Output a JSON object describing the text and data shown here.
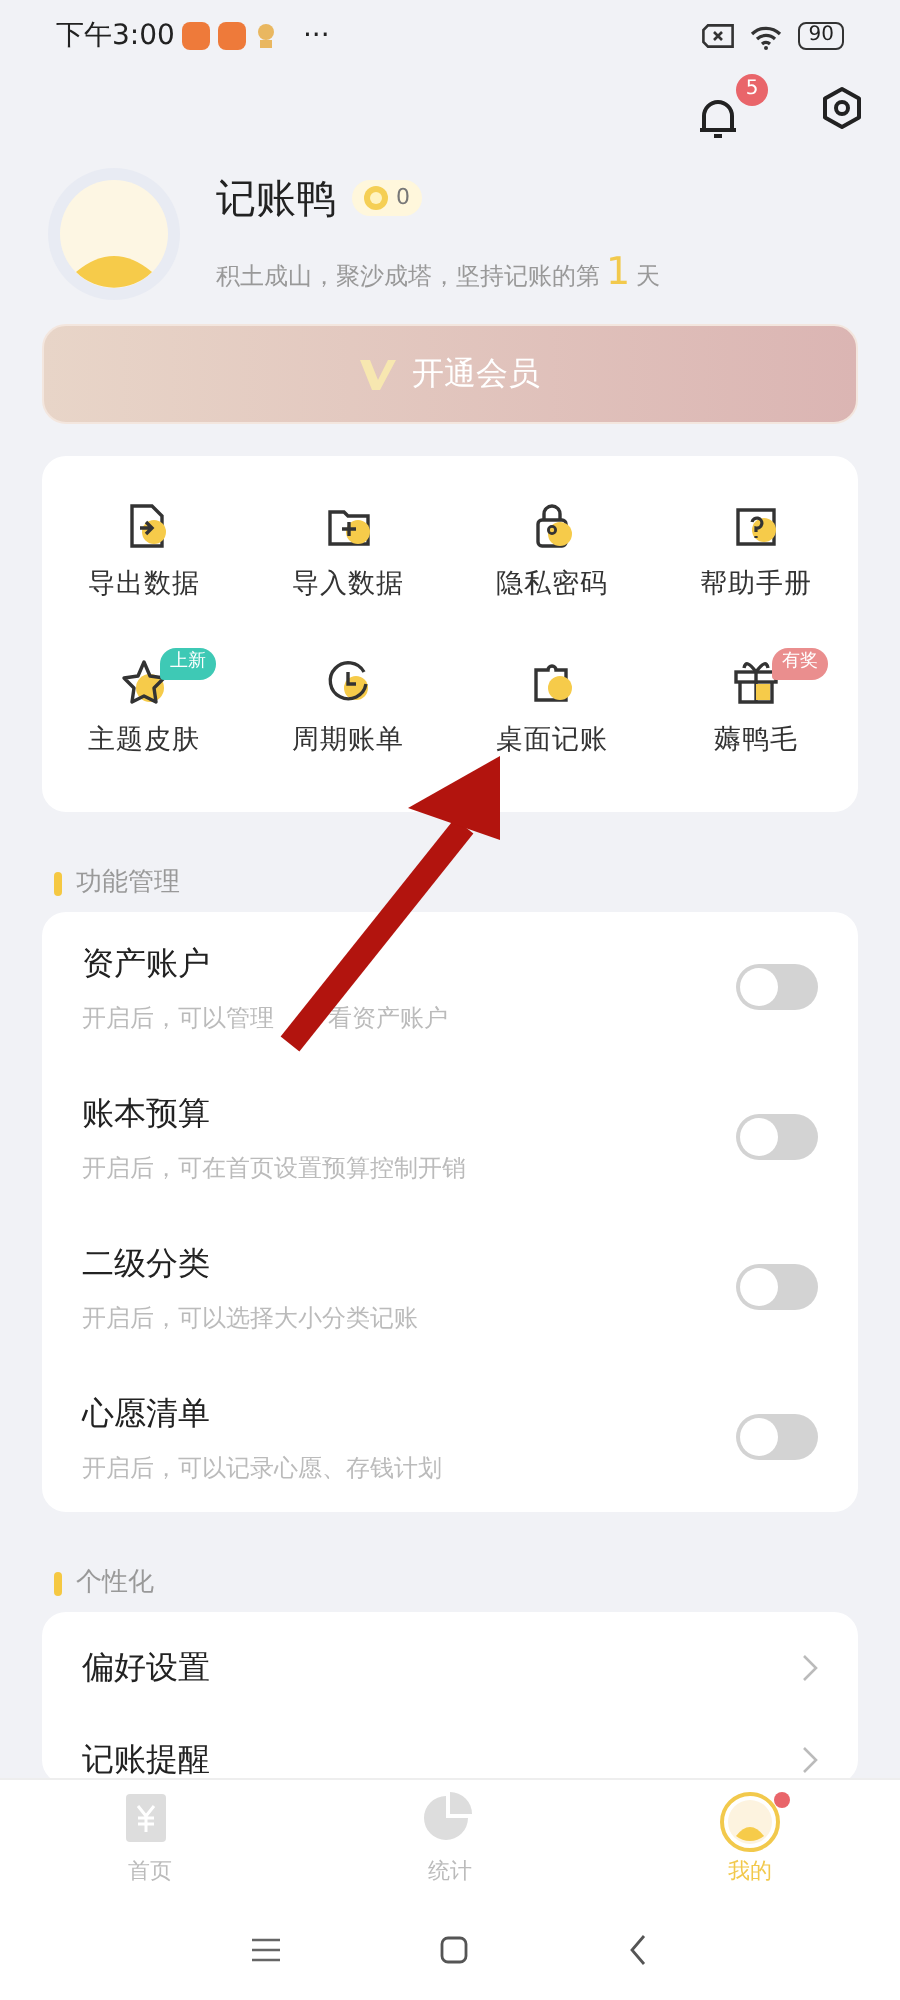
{
  "status_bar": {
    "time": "下午3:00",
    "more": "···",
    "battery": "90"
  },
  "header": {
    "notification_count": "5"
  },
  "profile": {
    "name": "记账鸭",
    "coins": "0",
    "motto_before": "积土成山，聚沙成塔，坚持记账的第",
    "days": "1",
    "motto_after": "天"
  },
  "vip_button": {
    "label": "开通会员"
  },
  "tools": [
    {
      "label": "导出数据"
    },
    {
      "label": "导入数据"
    },
    {
      "label": "隐私密码"
    },
    {
      "label": "帮助手册"
    },
    {
      "label": "主题皮肤",
      "badge": "上新",
      "color": "#3ec9b5"
    },
    {
      "label": "周期账单"
    },
    {
      "label": "桌面记账"
    },
    {
      "label": "薅鸭毛",
      "badge": "有奖",
      "color": "#ea8e8e"
    }
  ],
  "sections": [
    {
      "title": "功能管理",
      "kind": "toggles",
      "items": [
        {
          "title": "资产账户",
          "subtitle": [
            "开启后，可以管理",
            "看资产账户"
          ],
          "on": false
        },
        {
          "title": "账本预算",
          "subtitle": [
            "开启后，可在首页设置预算控制开销"
          ],
          "on": false
        },
        {
          "title": "二级分类",
          "subtitle": [
            "开启后，可以选择大小分类记账"
          ],
          "on": false
        },
        {
          "title": "心愿清单",
          "subtitle": [
            "开启后，可以记录心愿、存钱计划"
          ],
          "on": false
        }
      ]
    },
    {
      "title": "个性化",
      "kind": "links",
      "items": [
        {
          "title": "偏好设置"
        },
        {
          "title": "记账提醒"
        }
      ]
    }
  ],
  "tab_bar": [
    {
      "label": "首页",
      "selected": false,
      "dot": false
    },
    {
      "label": "统计",
      "selected": false,
      "dot": false
    },
    {
      "label": "我的",
      "selected": true,
      "dot": true
    }
  ]
}
